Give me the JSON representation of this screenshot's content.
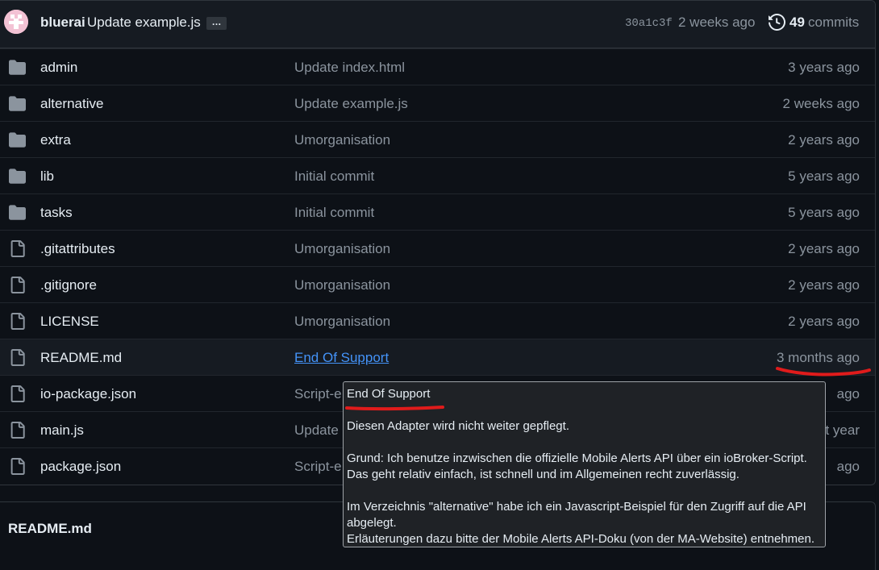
{
  "commit": {
    "author": "bluerai",
    "message": "Update example.js",
    "ellipsis": "…",
    "sha": "30a1c3f",
    "time": "2 weeks ago",
    "count": "49",
    "count_label": "commits"
  },
  "files": [
    {
      "name": "admin",
      "type": "folder",
      "message": "Update index.html",
      "age": "3 years ago"
    },
    {
      "name": "alternative",
      "type": "folder",
      "message": "Update example.js",
      "age": "2 weeks ago"
    },
    {
      "name": "extra",
      "type": "folder",
      "message": "Umorganisation",
      "age": "2 years ago"
    },
    {
      "name": "lib",
      "type": "folder",
      "message": "Initial commit",
      "age": "5 years ago"
    },
    {
      "name": "tasks",
      "type": "folder",
      "message": "Initial commit",
      "age": "5 years ago"
    },
    {
      "name": ".gitattributes",
      "type": "file",
      "message": "Umorganisation",
      "age": "2 years ago"
    },
    {
      "name": ".gitignore",
      "type": "file",
      "message": "Umorganisation",
      "age": "2 years ago"
    },
    {
      "name": "LICENSE",
      "type": "file",
      "message": "Umorganisation",
      "age": "2 years ago"
    },
    {
      "name": "README.md",
      "type": "file",
      "message": "End Of Support",
      "age": "3 months ago"
    },
    {
      "name": "io-package.json",
      "type": "file",
      "message": "Script-e",
      "age": "ago"
    },
    {
      "name": "main.js",
      "type": "file",
      "message": "Update",
      "age": "t year"
    },
    {
      "name": "package.json",
      "type": "file",
      "message": "Script-e",
      "age": "ago"
    }
  ],
  "readme": {
    "title": "README.md"
  },
  "tooltip": {
    "title": "End Of Support",
    "line1": "Diesen Adapter wird nicht weiter gepflegt.",
    "line2": "Grund: Ich benutze inzwischen die offizielle Mobile Alerts API über ein ioBroker-Script.",
    "line3": "Das geht relativ einfach, ist schnell und im Allgemeinen recht zuverlässig.",
    "line4": "Im Verzeichnis \"alternative\" habe ich ein Javascript-Beispiel für den Zugriff auf die API",
    "line5": "abgelegt.",
    "line6": "Erläuterungen dazu bitte der Mobile Alerts API-Doku (von der MA-Website) entnehmen."
  },
  "colors": {
    "background": "#0d1117",
    "header": "#161b22",
    "link": "#4493f8",
    "muted": "#8b949e",
    "annotation": "#e01b1b"
  }
}
